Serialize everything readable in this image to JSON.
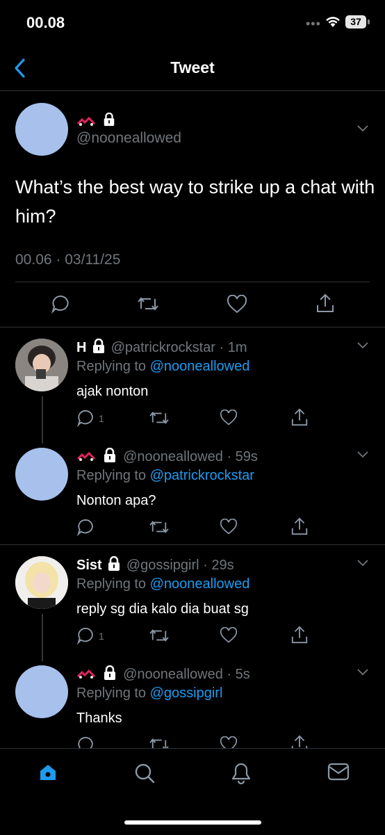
{
  "status_bar": {
    "time": "00.08",
    "signal_dots": "•••",
    "battery": "37"
  },
  "nav": {
    "title": "Tweet"
  },
  "main_tweet": {
    "handle": "@nooneallowed",
    "text": "What’s the best way to strike up a chat with him?",
    "timestamp": "00.06 · 03/11/25"
  },
  "replies": [
    {
      "name": "H",
      "handle": "@patrickrockstar",
      "time": "· 1m",
      "replying_prefix": "Replying to",
      "replying_to": "@nooneallowed",
      "text": "ajak nonton",
      "reply_count": "1"
    },
    {
      "name": "",
      "handle": "@nooneallowed",
      "time": "· 59s",
      "replying_prefix": "Replying to",
      "replying_to": "@patrickrockstar",
      "text": "Nonton apa?",
      "reply_count": ""
    },
    {
      "name": "Sist",
      "handle": "@gossipgirl",
      "time": "· 29s",
      "replying_prefix": "Replying to",
      "replying_to": "@nooneallowed",
      "text": "reply sg dia kalo dia buat sg",
      "reply_count": "1"
    },
    {
      "name": "",
      "handle": "@nooneallowed",
      "time": "· 5s",
      "replying_prefix": "Replying to",
      "replying_to": "@gossipgirl",
      "text": "Thanks",
      "reply_count": ""
    }
  ],
  "tabs": [
    "home-icon",
    "search-icon",
    "notifications-icon",
    "messages-icon"
  ],
  "colors": {
    "accent": "#1d9bf0",
    "avatar_placeholder": "#a7c1ec",
    "muted": "#71767b"
  }
}
